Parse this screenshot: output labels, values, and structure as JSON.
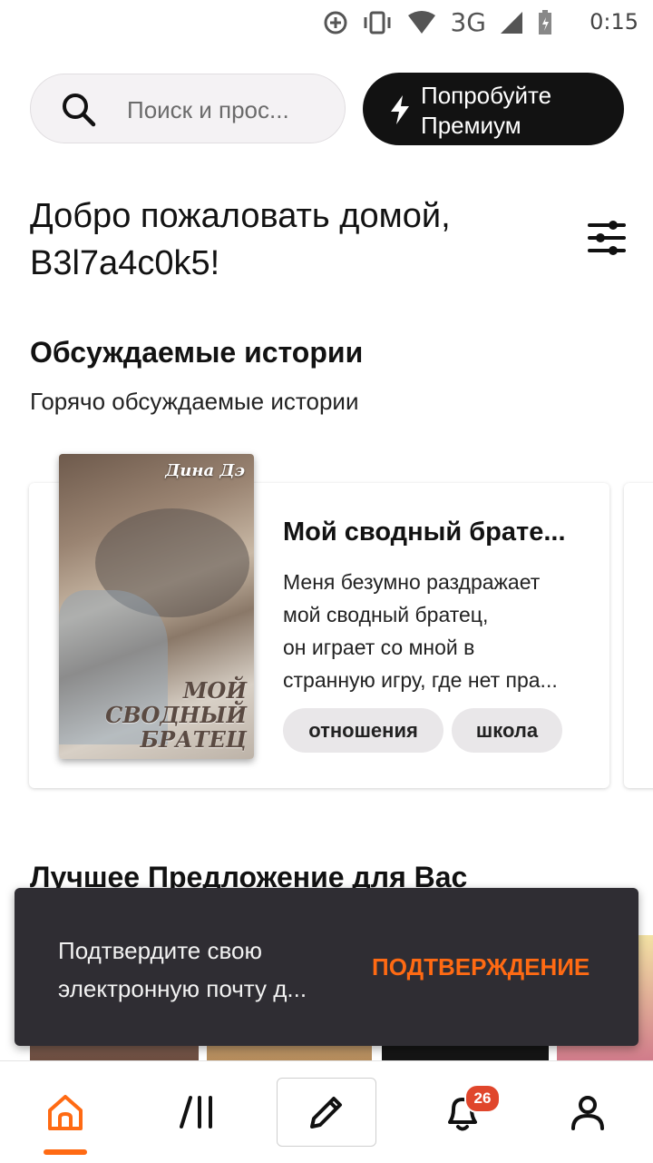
{
  "status_bar": {
    "network": "3G",
    "time": "0:15"
  },
  "search": {
    "placeholder": "Поиск и прос..."
  },
  "premium": {
    "label": "Попробуйте Премиум"
  },
  "welcome": {
    "line1": "Добро пожаловать домой,",
    "line2": "B3l7a4c0k5!"
  },
  "discussed": {
    "title": "Обсуждаемые истории",
    "subtitle": "Горячо обсуждаемые истории",
    "story": {
      "cover_author": "Дина Дэ",
      "cover_title_lines": [
        "МОЙ",
        "СВОДНЫЙ",
        "БРАТЕЦ"
      ],
      "title": "Мой сводный брате...",
      "description_lines": [
        "Меня безумно раздражает",
        "мой сводный братец,",
        "он играет со мной в",
        "странную игру, где нет пра..."
      ],
      "tags": [
        "отношения",
        "школа"
      ]
    }
  },
  "best_offer": {
    "title": "Лучшее Предложение для Вас"
  },
  "snackbar": {
    "text_lines": [
      "Подтвердите свою",
      "электронную почту д..."
    ],
    "action": "ПОДТВЕРЖДЕНИЕ"
  },
  "bottom_nav": {
    "notification_count": "26",
    "accent_color": "#ff6a13",
    "icons": [
      "home-icon",
      "library-icon",
      "write-icon",
      "bell-icon",
      "profile-icon"
    ]
  }
}
